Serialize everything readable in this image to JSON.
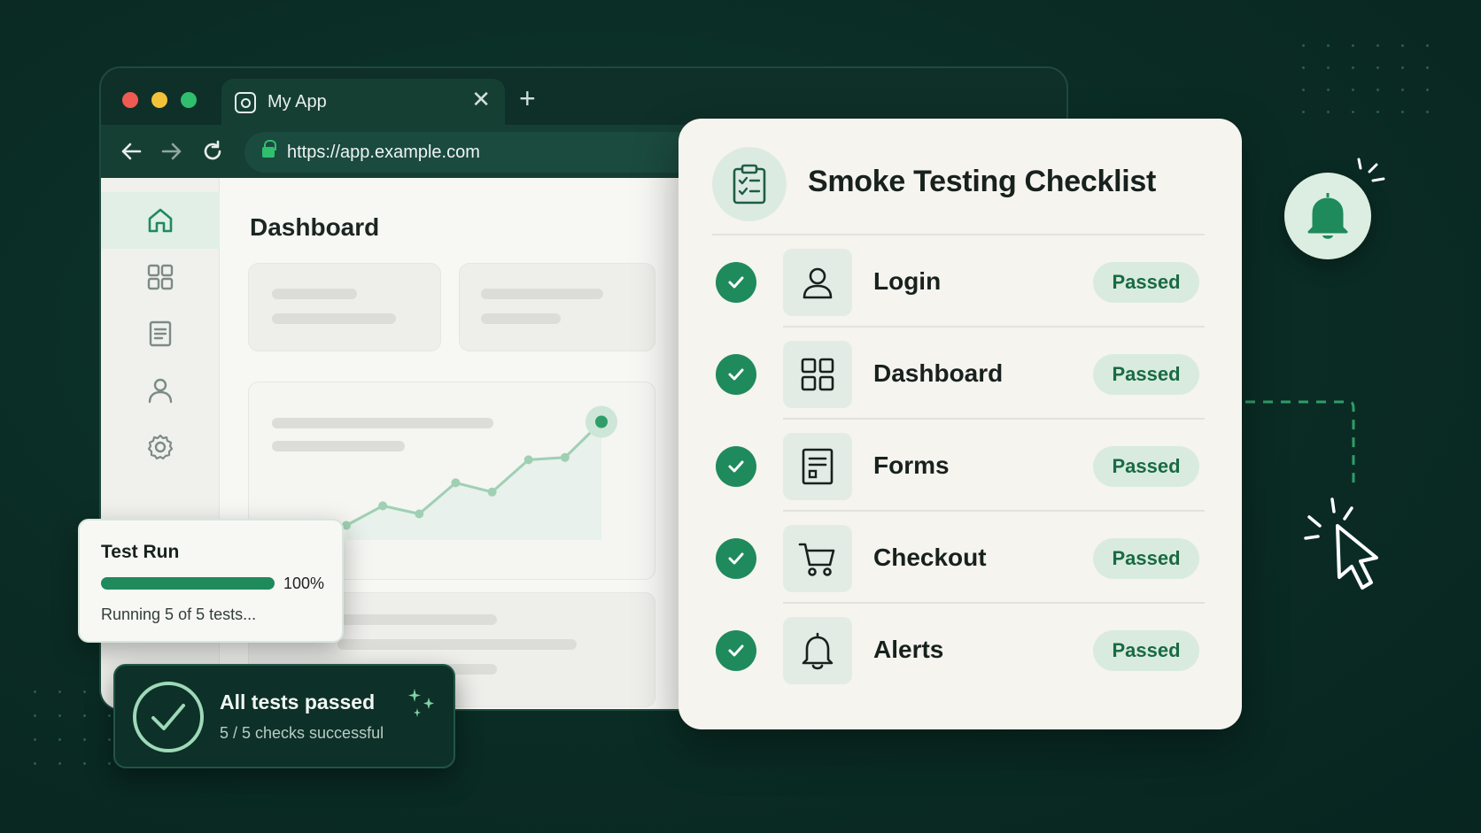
{
  "colors": {
    "background": "#0a2c24",
    "accent": "#1f8a5c",
    "panel": "#f6f4ef",
    "badge_bg": "#d9ebdf",
    "badge_text": "#1a6a44"
  },
  "browser": {
    "tab": {
      "title": "My App",
      "icon": "app-icon",
      "close_label": "✕"
    },
    "new_tab_label": "+",
    "nav": {
      "back_icon": "arrow-left-icon",
      "forward_icon": "arrow-right-icon",
      "reload_icon": "reload-icon"
    },
    "url": "https://app.example.com",
    "sidebar": {
      "items": [
        {
          "name": "home",
          "icon": "home-icon",
          "active": true
        },
        {
          "name": "dashboard",
          "icon": "grid-icon",
          "active": false
        },
        {
          "name": "forms",
          "icon": "document-icon",
          "active": false
        },
        {
          "name": "profile",
          "icon": "user-icon",
          "active": false
        },
        {
          "name": "settings",
          "icon": "gear-icon",
          "active": false
        }
      ]
    },
    "main": {
      "title": "Dashboard",
      "chart_trend": [
        0.05,
        0.22,
        0.15,
        0.42,
        0.34,
        0.62,
        0.64,
        0.95
      ]
    }
  },
  "checklist": {
    "title": "Smoke Testing Checklist",
    "icon": "clipboard-checklist-icon",
    "items": [
      {
        "label": "Login",
        "icon": "user-icon",
        "status": "Passed"
      },
      {
        "label": "Dashboard",
        "icon": "grid-icon",
        "status": "Passed"
      },
      {
        "label": "Forms",
        "icon": "document-icon",
        "status": "Passed"
      },
      {
        "label": "Checkout",
        "icon": "cart-icon",
        "status": "Passed"
      },
      {
        "label": "Alerts",
        "icon": "bell-icon",
        "status": "Passed"
      }
    ]
  },
  "test_run": {
    "title": "Test Run",
    "progress_percent": 100,
    "progress_label": "100%",
    "status": "Running 5 of 5 tests..."
  },
  "toast": {
    "title": "All tests passed",
    "subtitle": "5 / 5 checks successful",
    "icon": "check-circle-icon"
  },
  "notification": {
    "icon": "bell-icon"
  },
  "cursor": {
    "icon": "pointer-cursor-icon"
  }
}
